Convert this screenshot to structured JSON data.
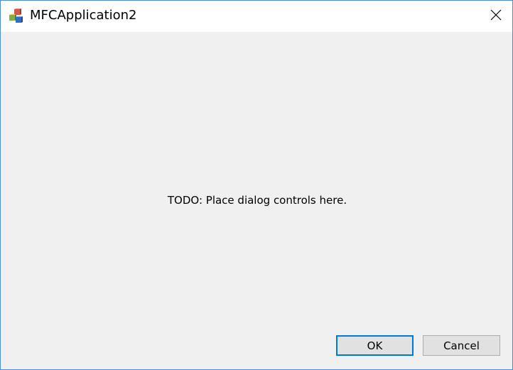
{
  "window": {
    "title": "MFCApplication2",
    "accent_border_color": "#4a8fd6",
    "background_color": "#f0f0f0",
    "app_icon": "mfc-app-icon",
    "close_icon": "close-icon"
  },
  "content": {
    "placeholder_text": "TODO: Place dialog controls here."
  },
  "buttons": {
    "ok_label": "OK",
    "cancel_label": "Cancel",
    "default_border_color": "#0078d7"
  }
}
